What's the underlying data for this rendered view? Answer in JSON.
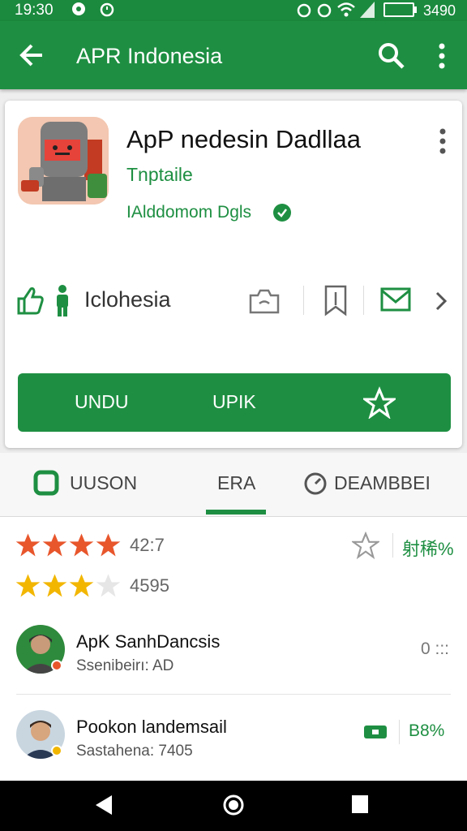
{
  "status_bar": {
    "time": "19:30",
    "battery_text": "3490"
  },
  "app_bar": {
    "title": "APR Indonesia"
  },
  "app": {
    "name": "ApP nedesin Dadllaa",
    "subtitle": "Tnptaile",
    "developer": "IAlddomom Dgls",
    "info_label": "Iclohesia"
  },
  "install_button": {
    "label_left": "UNDU",
    "label_middle": "UPIK"
  },
  "tabs": [
    {
      "label": "UUSON",
      "icon": "square-icon"
    },
    {
      "label": "ERA",
      "icon": ""
    },
    {
      "label": "DEAMBBEI",
      "icon": "clock-icon"
    }
  ],
  "ratings": {
    "row1": {
      "value": "42:7",
      "stars": 4,
      "percent": "射稀%"
    },
    "row2": {
      "value": "4595",
      "stars": 3
    }
  },
  "reviews": [
    {
      "name": "ApK SanhDancsis",
      "sub": "Ssenibeirı: AD",
      "meta": "0 :::"
    },
    {
      "name": "Pookon landemsail",
      "sub": "Sastahena: 7405",
      "meta": "B8%"
    }
  ],
  "colors": {
    "accent": "#1e8f42",
    "star_red": "#e8562c",
    "star_yellow": "#f2b600"
  }
}
